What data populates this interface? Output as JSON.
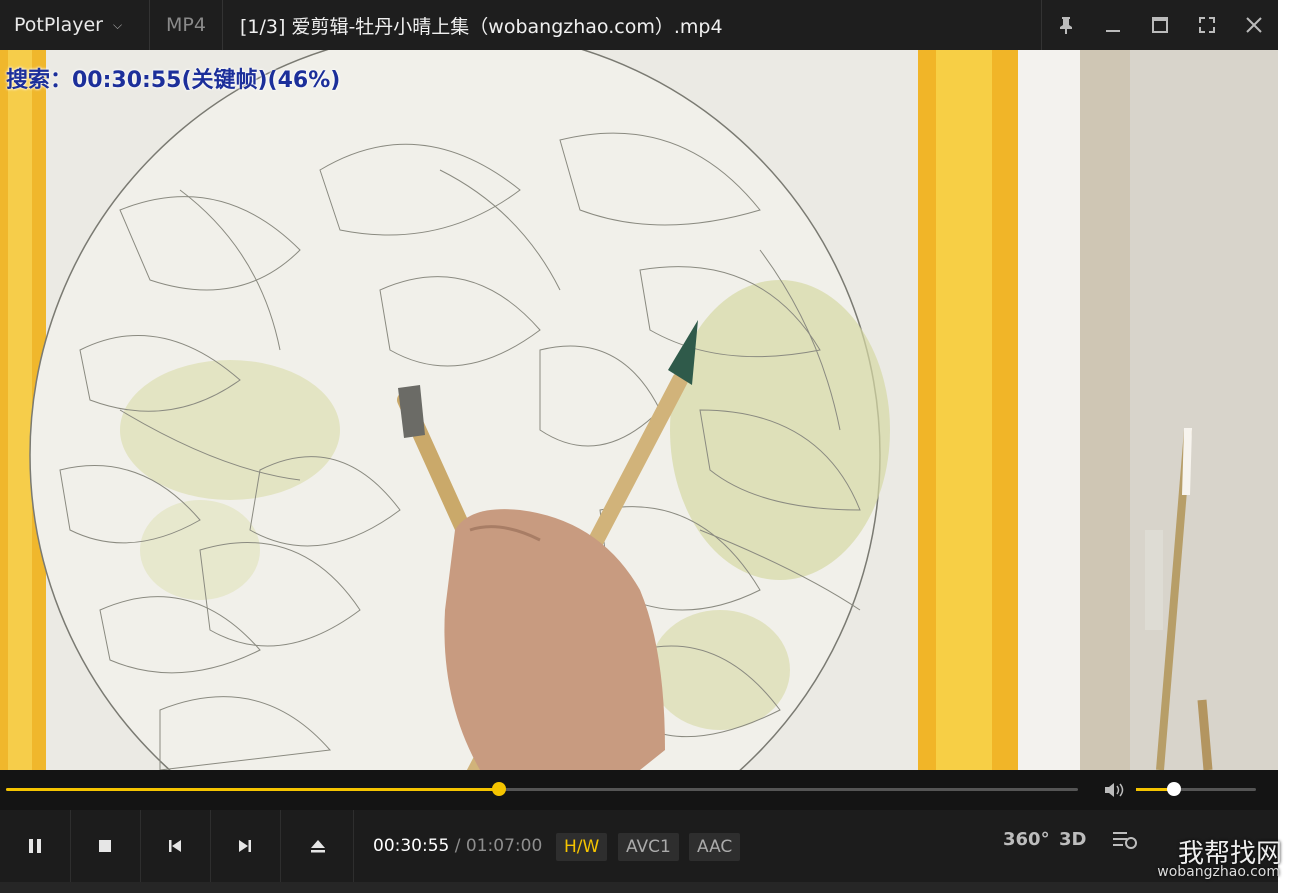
{
  "titlebar": {
    "brand": "PotPlayer",
    "format": "MP4",
    "file_title": "[1/3] 爱剪辑-牡丹小晴上集（wobangzhao.com）.mp4"
  },
  "osd": {
    "text": "搜索：00:30:55(关键帧)(46%)"
  },
  "seek": {
    "progress_fraction": 0.46
  },
  "volume": {
    "level_fraction": 0.32
  },
  "controls": {
    "current_time": "00:30:55",
    "separator": "/",
    "duration": "01:07:00",
    "tags": [
      "H/W",
      "AVC1",
      "AAC"
    ],
    "right_icons": [
      "360°",
      "3D"
    ]
  },
  "watermark": {
    "main": "我帮找网",
    "url": "wobangzhao.com"
  },
  "colors": {
    "accent": "#f5c400",
    "osd_text": "#1c2f9a",
    "bar_bg": "#1c1c1c"
  }
}
